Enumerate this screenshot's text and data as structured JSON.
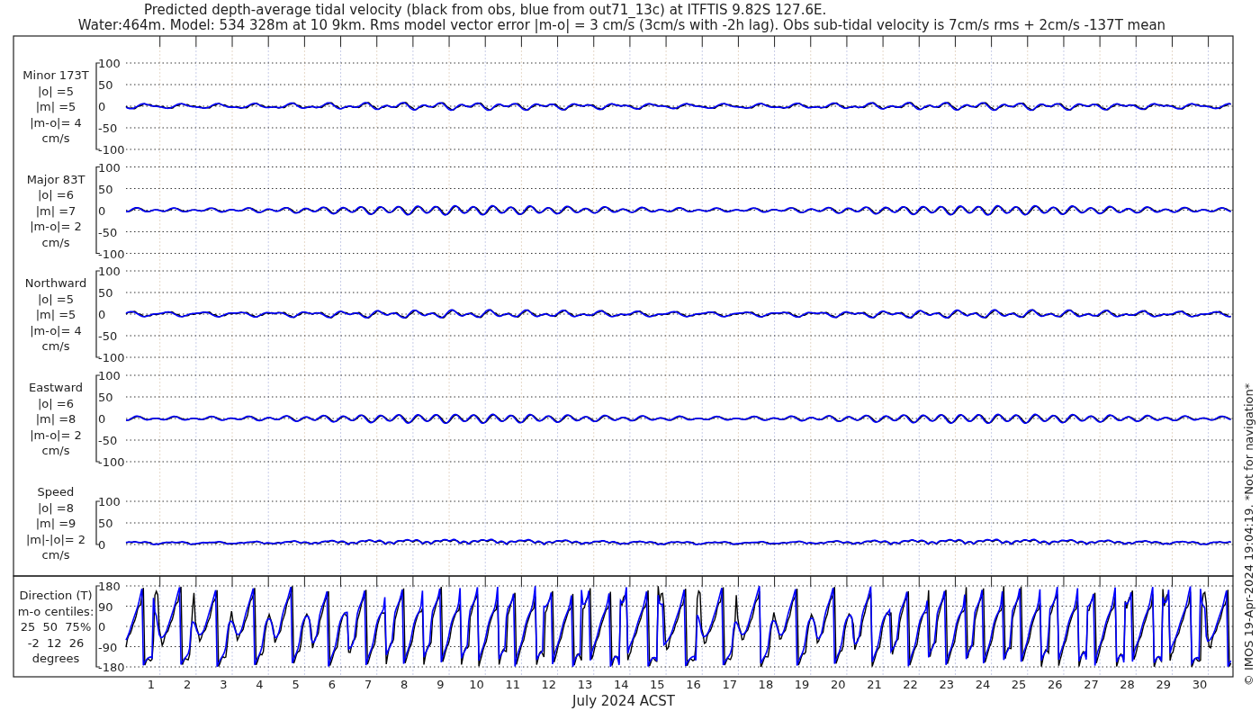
{
  "title": [
    "Predicted depth-average tidal velocity (black from obs, blue from out71_13c) at ITFTIS 9.82S 127.6E.",
    "Water:464m. Model: 534 328m at 10 9km. Rms model vector error |m-o| = 3 cm/s (3cm/s with -2h lag). Obs sub-tidal velocity is 7cm/s rms + 2cm/s -137T mean"
  ],
  "panels": [
    {
      "kind": "velocity",
      "label": [
        "Minor 173T",
        "|o| =5",
        "|m| =5",
        "|m-o|= 4",
        "cm/s"
      ],
      "yticks": [
        "100",
        "50",
        "0",
        "-50",
        "-100"
      ]
    },
    {
      "kind": "velocity",
      "label": [
        "Major 83T",
        "|o| =6",
        "|m| =7",
        "|m-o|= 2",
        "cm/s"
      ],
      "yticks": [
        "100",
        "50",
        "0",
        "-50",
        "-100"
      ]
    },
    {
      "kind": "velocity",
      "label": [
        "Northward",
        "|o| =5",
        "|m| =5",
        "|m-o|= 4",
        "cm/s"
      ],
      "yticks": [
        "100",
        "50",
        "0",
        "-50",
        "-100"
      ]
    },
    {
      "kind": "velocity",
      "label": [
        "Eastward",
        "|o| =6",
        "|m| =8",
        "|m-o|= 2",
        "cm/s"
      ],
      "yticks": [
        "100",
        "50",
        "0",
        "-50",
        "-100"
      ]
    },
    {
      "kind": "speed",
      "label": [
        "Speed",
        "|o| =8",
        "|m| =9",
        "|m|-|o|= 2",
        "cm/s"
      ],
      "yticks": [
        "100",
        "50",
        "0"
      ]
    },
    {
      "kind": "direction",
      "label": [
        "Direction (T)",
        "m-o centiles:",
        "25  50  75%",
        "-2  12  26",
        "degrees"
      ],
      "yticks": [
        "180",
        "90",
        "0",
        "-90",
        "-180"
      ]
    }
  ],
  "xticks": [
    "1",
    "2",
    "3",
    "4",
    "5",
    "6",
    "7",
    "8",
    "9",
    "10",
    "11",
    "12",
    "13",
    "14",
    "15",
    "16",
    "17",
    "18",
    "19",
    "20",
    "21",
    "22",
    "23",
    "24",
    "25",
    "26",
    "27",
    "28",
    "29",
    "30"
  ],
  "xlabel": "July 2024 ACST",
  "credit": "© IMOS 19-Apr-2024 19:04:19. *Not for navigation*"
}
